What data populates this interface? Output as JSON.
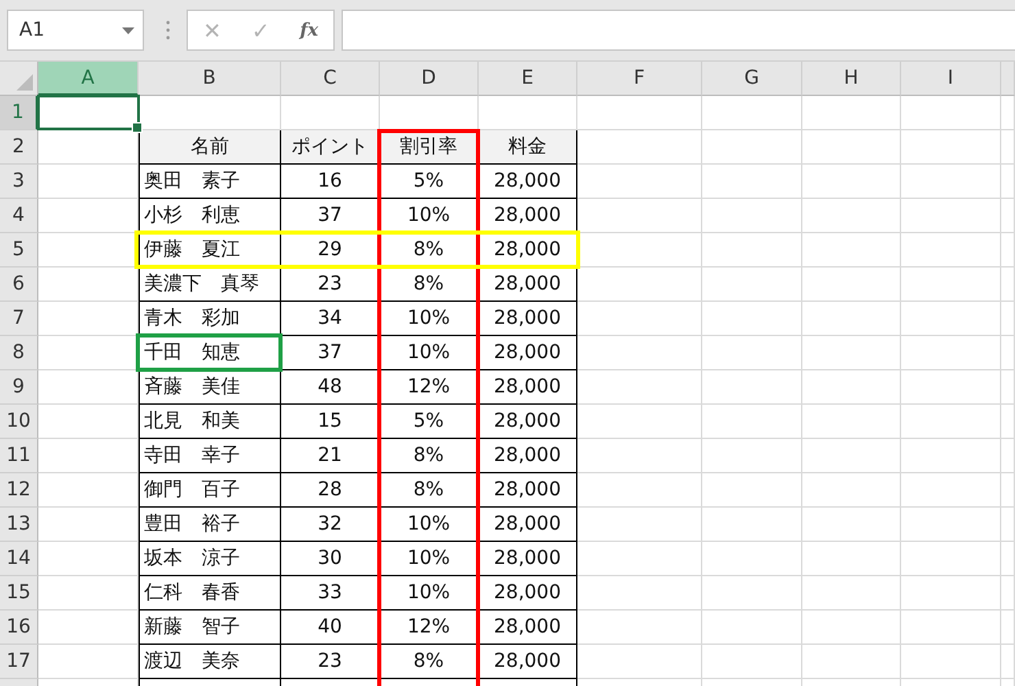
{
  "name_box": {
    "value": "A1"
  },
  "formula_bar": {
    "cancel": "✕",
    "enter": "✓",
    "function": "fx"
  },
  "column_headers": [
    {
      "label": "A",
      "selected": true,
      "outlined": false
    },
    {
      "label": "B",
      "selected": false,
      "outlined": false
    },
    {
      "label": "C",
      "selected": false,
      "outlined": false
    },
    {
      "label": "D",
      "selected": false,
      "outlined": true
    },
    {
      "label": "E",
      "selected": false,
      "outlined": false
    },
    {
      "label": "F",
      "selected": false,
      "outlined": false
    },
    {
      "label": "G",
      "selected": false,
      "outlined": false
    },
    {
      "label": "H",
      "selected": false,
      "outlined": false
    },
    {
      "label": "I",
      "selected": false,
      "outlined": false
    }
  ],
  "rows": [
    {
      "number": "1",
      "selected": true,
      "outlined": false,
      "name_outlined": false,
      "cells": []
    },
    {
      "number": "2",
      "selected": false,
      "outlined": false,
      "name_outlined": false,
      "header": true,
      "cells": [
        "名前",
        "ポイント",
        "割引率",
        "料金"
      ]
    },
    {
      "number": "3",
      "selected": false,
      "outlined": false,
      "name_outlined": false,
      "cells": [
        "奥田　素子",
        "16",
        "5%",
        "28,000"
      ]
    },
    {
      "number": "4",
      "selected": false,
      "outlined": false,
      "name_outlined": false,
      "cells": [
        "小杉　利恵",
        "37",
        "10%",
        "28,000"
      ]
    },
    {
      "number": "5",
      "selected": false,
      "outlined": true,
      "name_outlined": false,
      "cells": [
        "伊藤　夏江",
        "29",
        "8%",
        "28,000"
      ]
    },
    {
      "number": "6",
      "selected": false,
      "outlined": false,
      "name_outlined": false,
      "cells": [
        "美濃下　真琴",
        "23",
        "8%",
        "28,000"
      ]
    },
    {
      "number": "7",
      "selected": false,
      "outlined": false,
      "name_outlined": false,
      "cells": [
        "青木　彩加",
        "34",
        "10%",
        "28,000"
      ]
    },
    {
      "number": "8",
      "selected": false,
      "outlined": false,
      "name_outlined": true,
      "cells": [
        "千田　知恵",
        "37",
        "10%",
        "28,000"
      ]
    },
    {
      "number": "9",
      "selected": false,
      "outlined": false,
      "name_outlined": false,
      "cells": [
        "斉藤　美佳",
        "48",
        "12%",
        "28,000"
      ]
    },
    {
      "number": "10",
      "selected": false,
      "outlined": false,
      "name_outlined": false,
      "cells": [
        "北見　和美",
        "15",
        "5%",
        "28,000"
      ]
    },
    {
      "number": "11",
      "selected": false,
      "outlined": false,
      "name_outlined": false,
      "cells": [
        "寺田　幸子",
        "21",
        "8%",
        "28,000"
      ]
    },
    {
      "number": "12",
      "selected": false,
      "outlined": false,
      "name_outlined": false,
      "cells": [
        "御門　百子",
        "28",
        "8%",
        "28,000"
      ]
    },
    {
      "number": "13",
      "selected": false,
      "outlined": false,
      "name_outlined": false,
      "cells": [
        "豊田　裕子",
        "32",
        "10%",
        "28,000"
      ]
    },
    {
      "number": "14",
      "selected": false,
      "outlined": false,
      "name_outlined": false,
      "cells": [
        "坂本　涼子",
        "30",
        "10%",
        "28,000"
      ]
    },
    {
      "number": "15",
      "selected": false,
      "outlined": false,
      "name_outlined": false,
      "cells": [
        "仁科　春香",
        "33",
        "10%",
        "28,000"
      ]
    },
    {
      "number": "16",
      "selected": false,
      "outlined": false,
      "name_outlined": false,
      "cells": [
        "新藤　智子",
        "40",
        "12%",
        "28,000"
      ]
    },
    {
      "number": "17",
      "selected": false,
      "outlined": false,
      "name_outlined": false,
      "cells": [
        "渡辺　美奈",
        "23",
        "8%",
        "28,000"
      ]
    }
  ]
}
